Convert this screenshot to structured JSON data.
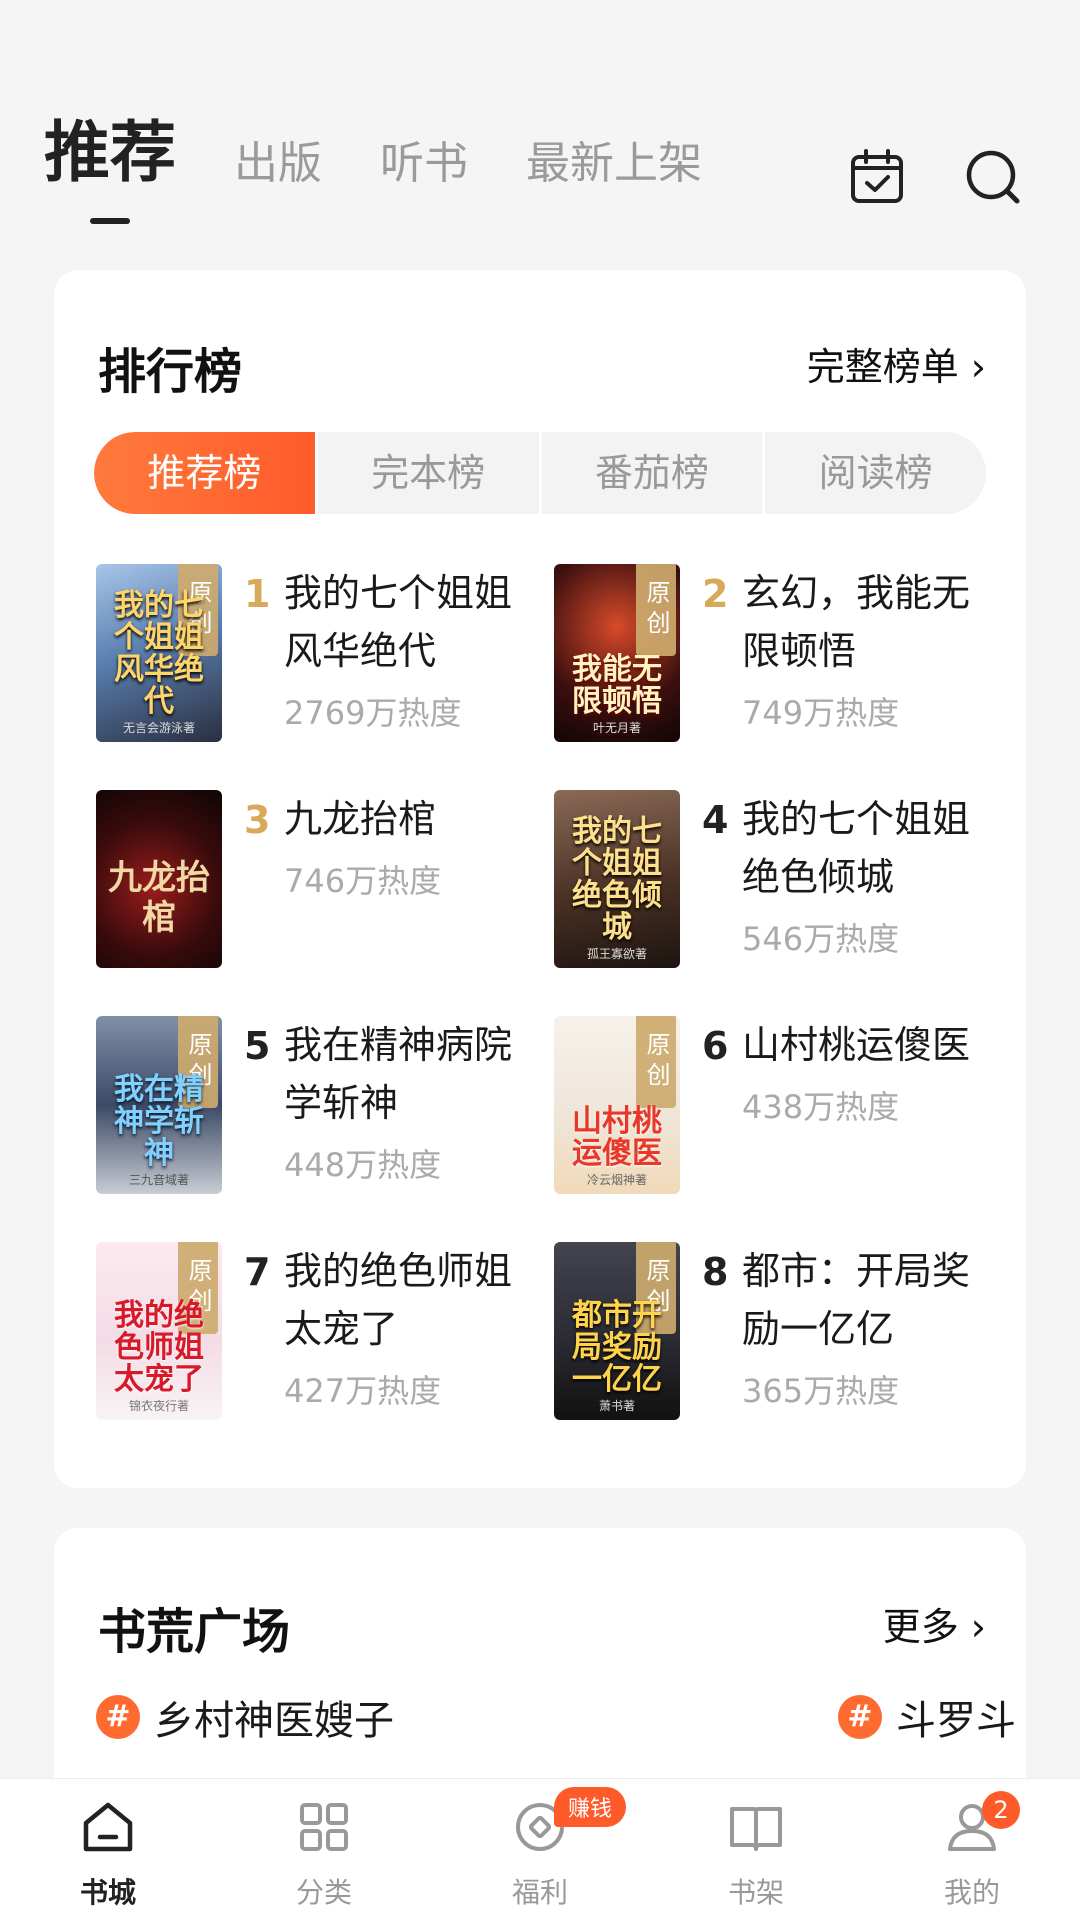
{
  "header": {
    "tabs": [
      {
        "label": "推荐",
        "active": true
      },
      {
        "label": "出版",
        "active": false
      },
      {
        "label": "听书",
        "active": false
      },
      {
        "label": "最新上架",
        "active": false
      }
    ],
    "icons": [
      "calendar-check-icon",
      "search-icon"
    ]
  },
  "ranking": {
    "title": "排行榜",
    "link_label": "完整榜单 ›",
    "segments": [
      {
        "label": "推荐榜",
        "active": true
      },
      {
        "label": "完本榜",
        "active": false
      },
      {
        "label": "番茄榜",
        "active": false
      },
      {
        "label": "阅读榜",
        "active": false
      }
    ],
    "badge_label": "原创",
    "books": [
      {
        "rank": "1",
        "title": "我的七个姐姐风华绝代",
        "heat": "2769万热度",
        "cover_text": "我的七个姐姐风华绝代",
        "cover_author": "无言会游泳著",
        "has_badge": true,
        "cover_color": "#5a7fb0"
      },
      {
        "rank": "2",
        "title": "玄幻，我能无限顿悟",
        "heat": "749万热度",
        "cover_text": "我能无限顿悟",
        "cover_author": "叶无月著",
        "has_badge": true,
        "cover_color": "#3b0f0f"
      },
      {
        "rank": "3",
        "title": "九龙抬棺",
        "heat": "746万热度",
        "cover_text": "九龙抬棺",
        "cover_author": "",
        "has_badge": false,
        "cover_color": "#1e0d0d"
      },
      {
        "rank": "4",
        "title": "我的七个姐姐绝色倾城",
        "heat": "546万热度",
        "cover_text": "我的七个姐姐绝色倾城",
        "cover_author": "孤王寡欲著",
        "has_badge": false,
        "cover_color": "#4a3124"
      },
      {
        "rank": "5",
        "title": "我在精神病院学斩神",
        "heat": "448万热度",
        "cover_text": "我在精神学斩神",
        "cover_author": "三九音域著",
        "has_badge": true,
        "cover_color": "#3b4a66"
      },
      {
        "rank": "6",
        "title": "山村桃运傻医",
        "heat": "438万热度",
        "cover_text": "山村桃运傻医",
        "cover_author": "冷云烟神著",
        "has_badge": true,
        "cover_color": "#efe6da"
      },
      {
        "rank": "7",
        "title": "我的绝色师姐太宠了",
        "heat": "427万热度",
        "cover_text": "我的绝色师姐太宠了",
        "cover_author": "锦衣夜行著",
        "has_badge": true,
        "cover_color": "#f4dce6"
      },
      {
        "rank": "8",
        "title": "都市：开局奖励一亿亿",
        "heat": "365万热度",
        "cover_text": "都市开局奖励一亿亿",
        "cover_author": "萧书著",
        "has_badge": true,
        "cover_color": "#2b2b33"
      }
    ]
  },
  "plaza": {
    "title": "书荒广场",
    "link_label": "更多 ›",
    "tags": [
      {
        "hash": "#",
        "label": "乡村神医嫂子"
      },
      {
        "hash": "#",
        "label": "斗罗斗"
      }
    ]
  },
  "bottom_nav": [
    {
      "label": "书城",
      "icon": "home-icon",
      "active": true
    },
    {
      "label": "分类",
      "icon": "grid-icon",
      "active": false
    },
    {
      "label": "福利",
      "icon": "coin-icon",
      "active": false,
      "pill": "赚钱"
    },
    {
      "label": "书架",
      "icon": "book-icon",
      "active": false
    },
    {
      "label": "我的",
      "icon": "user-icon",
      "active": false,
      "badge": "2"
    }
  ]
}
